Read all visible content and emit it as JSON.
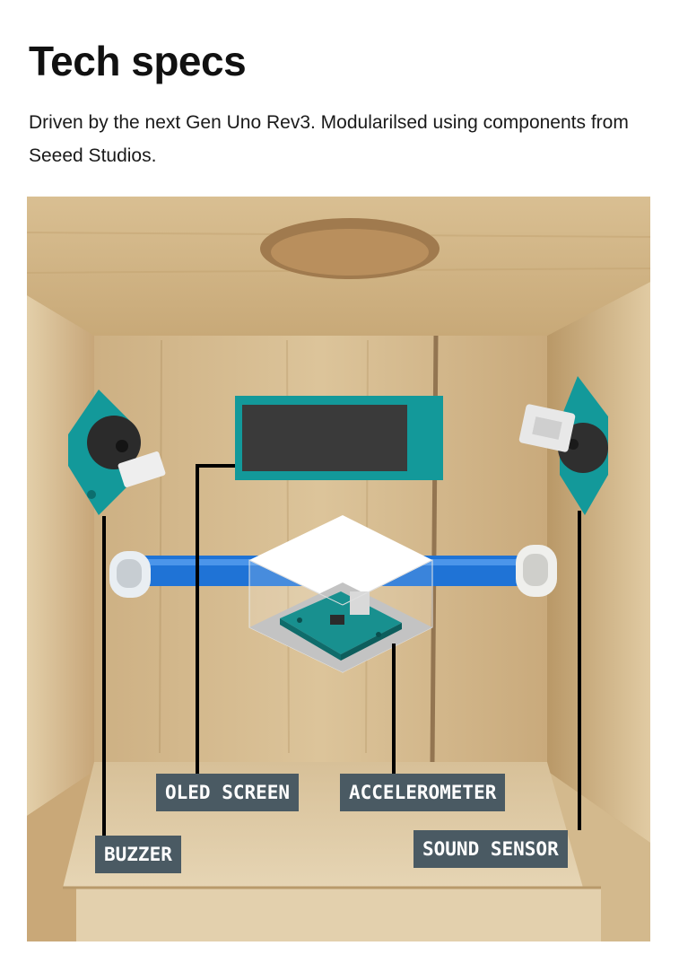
{
  "page": {
    "title": "Tech specs",
    "description": "Driven by the next Gen Uno Rev3. Modularilsed using components from Seeed Studios."
  },
  "figure": {
    "labels": {
      "oled": "OLED SCREEN",
      "accelerometer": "ACCELEROMETER",
      "buzzer": "BUZZER",
      "sound_sensor": "SOUND SENSOR"
    },
    "colors": {
      "label_bg": "#4a5a63",
      "module_teal": "#13999a",
      "cable_blue": "#1f73d6",
      "wood": "#d8bf95"
    }
  }
}
